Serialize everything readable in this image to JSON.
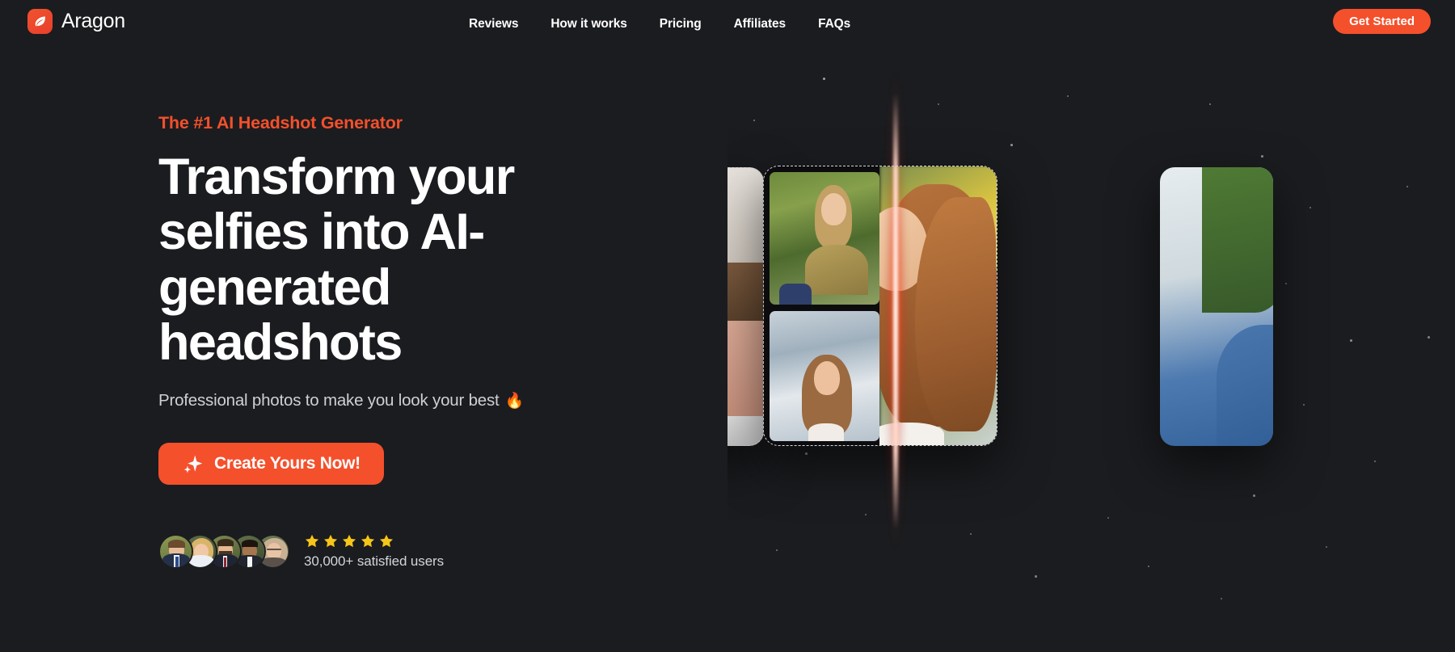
{
  "theme": {
    "background": "#1b1c1f",
    "accent": "#f4502c",
    "text_primary": "#ffffff",
    "text_secondary": "#cfd0d3",
    "star_color": "#f5c518",
    "laser_color": "#ff4a28"
  },
  "header": {
    "brand_name": "Aragon",
    "brand_icon": "leaf-flame-icon",
    "nav_items": [
      {
        "label": "Reviews"
      },
      {
        "label": "How it works"
      },
      {
        "label": "Pricing"
      },
      {
        "label": "Affiliates"
      },
      {
        "label": "FAQs"
      }
    ],
    "cta_label": "Get Started"
  },
  "hero": {
    "eyebrow": "The #1 AI Headshot Generator",
    "headline": "Transform your selfies into AI-generated headshots",
    "subtitle": "Professional photos to make you look your best",
    "subtitle_emoji": "🔥",
    "cta_label": "Create Yours Now!",
    "cta_icon": "sparkle-icon"
  },
  "social_proof": {
    "avatar_count": 5,
    "avatars": [
      {
        "alt": "man in navy suit with blue tie"
      },
      {
        "alt": "blonde woman in white blouse"
      },
      {
        "alt": "bearded man in dark suit with red tie"
      },
      {
        "alt": "man in dark suit and white shirt"
      },
      {
        "alt": "woman with glasses and long hair"
      }
    ],
    "star_count": 5,
    "stars_filled": 5,
    "rating_text": "30,000+ satisfied users"
  },
  "visual": {
    "cards": [
      {
        "id": "card-left",
        "type": "partial-selfie-card",
        "dashed_border": true,
        "alt": "partially visible selfie card"
      },
      {
        "id": "card-center",
        "type": "before-after-card",
        "dashed_border": true,
        "alt": "two selfie thumbnails transformed into an AI headshot"
      },
      {
        "id": "card-right",
        "type": "partial-headshot-card",
        "dashed_border": false,
        "alt": "partially visible headshot of person in blue blazer"
      }
    ],
    "center_card": {
      "before_thumbnails": [
        {
          "alt": "woman sitting outdoors in patterned top with green trees behind"
        },
        {
          "alt": "woman smiling indoors near a bright window"
        }
      ],
      "after_image": {
        "alt": "AI-generated headshot, woman with long wavy auburn hair, blurred golden background"
      }
    },
    "laser": {
      "name": "scan-beam",
      "orientation": "vertical"
    },
    "starfield": {
      "name": "particle-dots",
      "visible": true
    }
  }
}
